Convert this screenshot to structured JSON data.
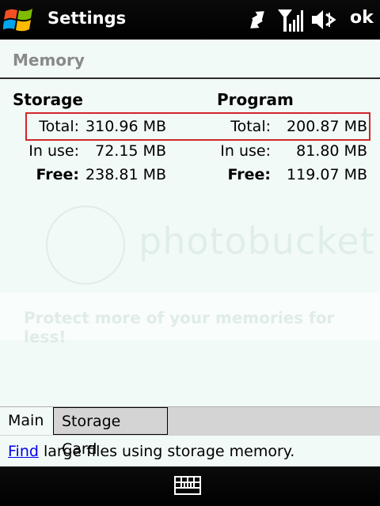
{
  "titlebar": {
    "title": "Settings",
    "ok_label": "ok",
    "icons": [
      "windows-start-icon",
      "sync-arrows-icon",
      "signal-strength-icon",
      "speaker-muted-icon"
    ]
  },
  "header": {
    "heading": "Memory"
  },
  "storage": {
    "heading": "Storage",
    "rows": [
      {
        "label": "Total:",
        "value": "310.96 MB"
      },
      {
        "label": "In use:",
        "value": "72.15 MB"
      },
      {
        "label": "Free:",
        "value": "238.81 MB"
      }
    ]
  },
  "program": {
    "heading": "Program",
    "rows": [
      {
        "label": "Total:",
        "value": "200.87 MB"
      },
      {
        "label": "In use:",
        "value": "81.80 MB"
      },
      {
        "label": "Free:",
        "value": "119.07 MB"
      }
    ]
  },
  "watermark": {
    "brand": "photobucket",
    "tagline": "Protect more of your memories for less!"
  },
  "tabs": [
    {
      "label": "Main",
      "selected": true
    },
    {
      "label": "Storage Card",
      "selected": false
    }
  ],
  "find": {
    "link": "Find",
    "rest": " large files using storage memory."
  },
  "softbar": {
    "icon": "keyboard-icon"
  },
  "colors": {
    "highlight_border": "#d0262b",
    "link": "#0000ee",
    "heading_gray": "#8a8a8a"
  }
}
